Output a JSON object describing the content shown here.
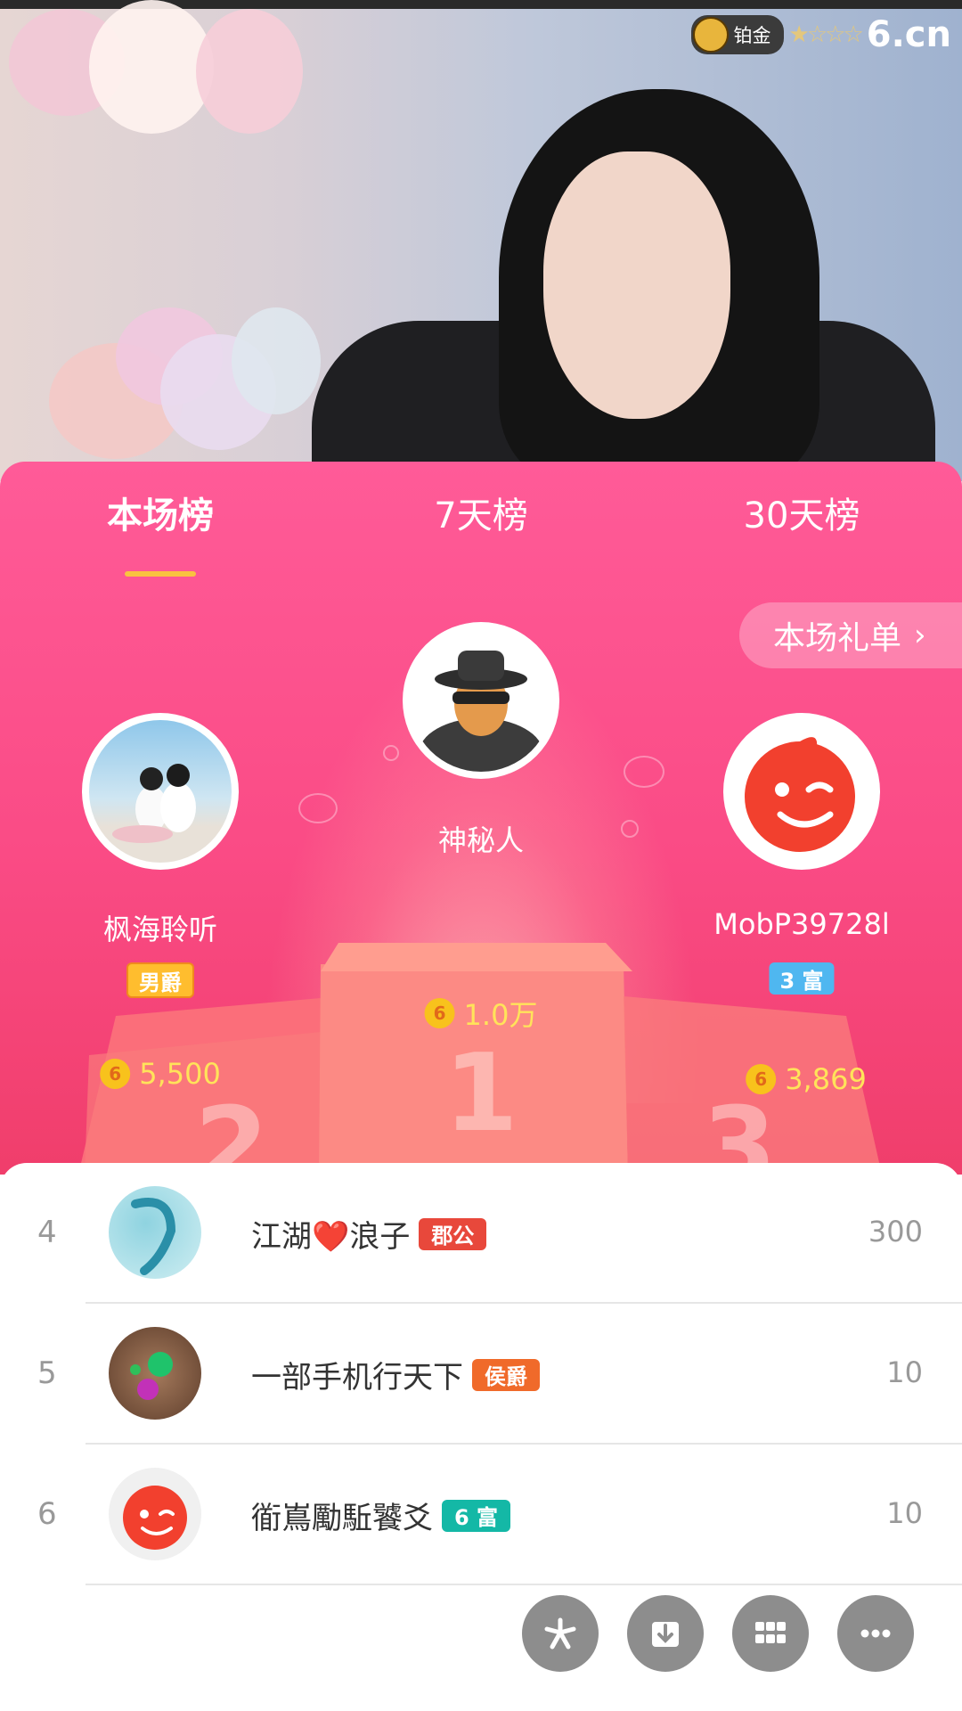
{
  "stream": {
    "level_badge": "铂金",
    "stars": "★☆☆☆",
    "site_logo": "6.cn"
  },
  "tabs": [
    {
      "label": "本场榜",
      "active": true
    },
    {
      "label": "7天榜",
      "active": false
    },
    {
      "label": "30天榜",
      "active": false
    }
  ],
  "gift_list_button": "本场礼单",
  "podium": {
    "first": {
      "name": "神秘人",
      "score": "1.0万",
      "number": "1"
    },
    "second": {
      "name": "枫海聆听",
      "badge": "男爵",
      "score": "5,500",
      "number": "2"
    },
    "third": {
      "name": "MobP39728l",
      "badge": "3 富",
      "score": "3,869",
      "number": "3"
    }
  },
  "coin_glyph": "6",
  "ranking": [
    {
      "rank": "4",
      "name": "江湖❤️浪子",
      "badge": "郡公",
      "badge_color": "#e8483b",
      "amount": "300",
      "avatar_icon": "dragon-avatar"
    },
    {
      "rank": "5",
      "name": "一部手机行天下",
      "badge": "侯爵",
      "badge_color": "#f06a2a",
      "amount": "10",
      "avatar_icon": "jewelry-avatar"
    },
    {
      "rank": "6",
      "name": "衜嶌勵駈饕爻",
      "badge": "6 富",
      "badge_color": "#14b8a6",
      "amount": "10",
      "avatar_icon": "default-6cn-avatar"
    }
  ],
  "colors": {
    "panel_top": "#ff5b98",
    "panel_bottom": "#f03e6b",
    "score_text": "#ffe35a",
    "tab_underline": "#f9c240"
  }
}
